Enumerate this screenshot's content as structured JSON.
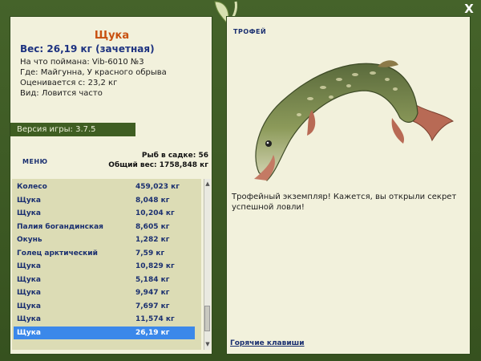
{
  "window": {
    "close_icon": "close-icon",
    "close_glyph": "X"
  },
  "fish_card": {
    "name": "Щука",
    "weight": "Вес: 26,19 кг (зачетная)",
    "lure": "На что поймана: Vib-6010 №3",
    "location": "Где: Майгунна, У красного обрыва",
    "valued_from": "Оценивается с: 23,2 кг",
    "kind": "Вид: Ловится часто"
  },
  "version": "Версия игры: 3.7.5",
  "menu_label": "МЕНЮ",
  "stats": {
    "fish_count": "Рыб в садке: 56",
    "total_weight": "Общий вес: 1758,848 кг"
  },
  "catch_list": [
    {
      "name": "Колесо",
      "weight": "459,023 кг"
    },
    {
      "name": "Щука",
      "weight": "8,048 кг"
    },
    {
      "name": "Щука",
      "weight": "10,204 кг"
    },
    {
      "name": "Палия богандинская",
      "weight": "8,605 кг"
    },
    {
      "name": "Окунь",
      "weight": "1,282 кг"
    },
    {
      "name": "Голец арктический",
      "weight": "7,59 кг"
    },
    {
      "name": "Щука",
      "weight": "10,829 кг"
    },
    {
      "name": "Щука",
      "weight": "5,184 кг"
    },
    {
      "name": "Щука",
      "weight": "9,947 кг"
    },
    {
      "name": "Щука",
      "weight": "7,697 кг"
    },
    {
      "name": "Щука",
      "weight": "11,574 кг"
    },
    {
      "name": "Щука",
      "weight": "26,19 кг"
    }
  ],
  "selected_index": 11,
  "trophy": {
    "label": "ТРОФЕЙ",
    "text": "Трофейный экземпляр! Кажется, вы открыли секрет успешной ловли!"
  },
  "hotkeys_link": "Горячие клавиши",
  "colors": {
    "frame": "#3e5a25",
    "panel": "#f2f1dc",
    "list_bg": "#dcdcb5",
    "selected": "#3b88ea",
    "name_accent": "#c8500f",
    "link": "#1a2f70"
  }
}
